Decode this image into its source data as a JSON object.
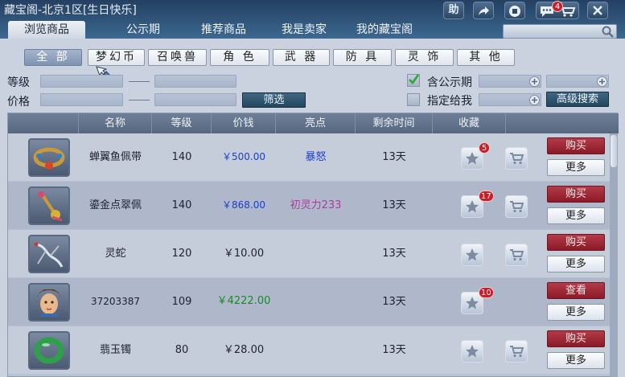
{
  "window": {
    "title": "藏宝阁-北京1区[生日快乐]"
  },
  "titlebar": {
    "help_label": "助",
    "notify_count": "4"
  },
  "nav": {
    "tabs": [
      "浏览商品",
      "公示期",
      "推荐商品",
      "我是卖家",
      "我的藏宝阁"
    ],
    "active": 0
  },
  "search": {
    "value": "",
    "placeholder": ""
  },
  "categories": [
    "全 部",
    "梦幻币",
    "召唤兽",
    "角 色",
    "武 器",
    "防 具",
    "灵 饰",
    "其 他"
  ],
  "filters": {
    "level_label": "等级",
    "price_label": "价格",
    "filter_button": "筛选",
    "public_label": "含公示期",
    "public_checked": true,
    "assign_label": "指定给我",
    "assign_checked": false,
    "advanced_button": "高级搜索"
  },
  "table": {
    "headers": [
      "名称",
      "等级",
      "价钱",
      "亮点",
      "剩余时间",
      "收藏"
    ],
    "rows": [
      {
        "icon": "belt",
        "name": "蝉翼鱼佩带",
        "level": "140",
        "price": "￥500.00",
        "price_color": "#1a3fd0",
        "highlight": "暴怒",
        "highlight_color": "#1a3fd0",
        "time": "13天",
        "fav_count": "5",
        "action": "购买",
        "more": "更多"
      },
      {
        "icon": "pendant",
        "name": "鎏金点翠佩",
        "level": "140",
        "price": "￥868.00",
        "price_color": "#1a3fd0",
        "highlight": "初灵力233",
        "highlight_color": "#b03aa0",
        "time": "13天",
        "fav_count": "17",
        "action": "购买",
        "more": "更多"
      },
      {
        "icon": "snake",
        "name": "灵蛇",
        "level": "120",
        "price": "￥10.00",
        "price_color": "#1d2230",
        "highlight": "",
        "highlight_color": "#1d2230",
        "time": "13天",
        "fav_count": "",
        "action": "购买",
        "more": "更多"
      },
      {
        "icon": "character",
        "name": "37203387",
        "level": "109",
        "price": "￥4222.00",
        "price_color": "#1a8a2a",
        "highlight": "",
        "highlight_color": "#1d2230",
        "time": "13天",
        "fav_count": "10",
        "action": "查看",
        "more": "更多"
      },
      {
        "icon": "jade-bracelet",
        "name": "翡玉镯",
        "level": "80",
        "price": "￥28.00",
        "price_color": "#1d2230",
        "highlight": "",
        "highlight_color": "#1d2230",
        "time": "13天",
        "fav_count": "",
        "action": "购买",
        "more": "更多"
      }
    ]
  }
}
